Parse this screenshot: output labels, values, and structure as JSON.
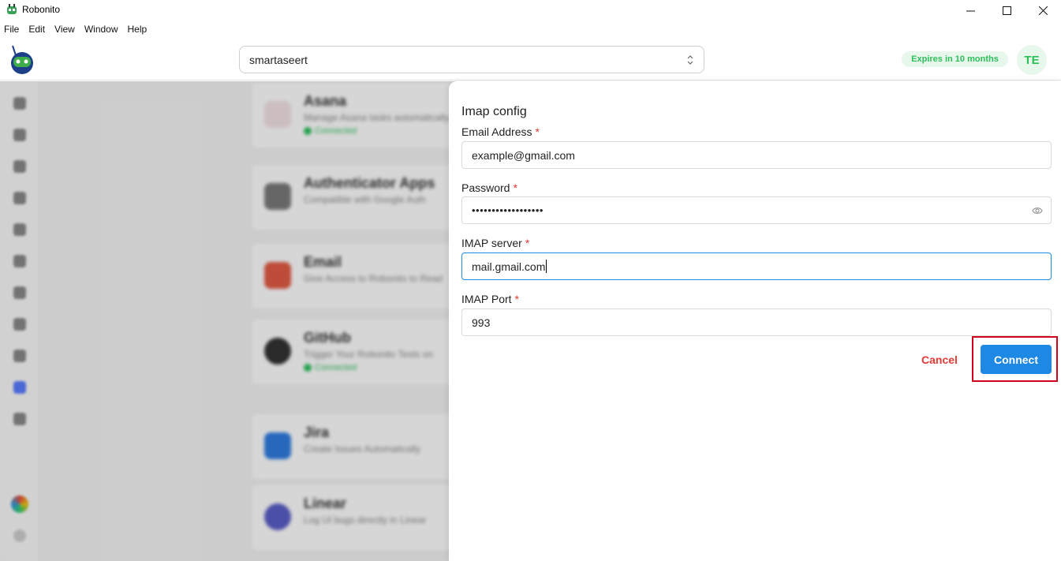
{
  "window": {
    "title": "Robonito",
    "controls": {
      "minimize": "—",
      "maximize": "☐",
      "close": "✕"
    }
  },
  "menu": [
    "File",
    "Edit",
    "View",
    "Window",
    "Help"
  ],
  "header": {
    "workspace": "smartaseert",
    "expiry": "Expires in 10 months",
    "avatar_initials": "TE"
  },
  "background_cards": [
    {
      "title": "Asana",
      "desc": "Manage Asana tasks automatically",
      "status": "Connected",
      "icon_color": "#e8e8e8"
    },
    {
      "title": "Authenticator Apps",
      "desc": "Compatible with Google Auth",
      "status": "",
      "icon_color": "#7a7a7a"
    },
    {
      "title": "Email",
      "desc": "Give Access to Robonito to Read",
      "status": "",
      "icon_color": "#e25b45"
    },
    {
      "title": "GitHub",
      "desc": "Trigger Your Robonito Tests on",
      "status": "Connected",
      "icon_color": "#333333"
    },
    {
      "title": "Jira",
      "desc": "Create Issues Automatically",
      "status": "",
      "icon_color": "#2f7de1"
    },
    {
      "title": "Linear",
      "desc": "Log UI bugs directly in Linear",
      "status": "",
      "icon_color": "#5a5fc8"
    }
  ],
  "form": {
    "title": "Imap config",
    "email_label": "Email Address",
    "email_value": "example@gmail.com",
    "password_label": "Password",
    "password_value": "••••••••••••••••••",
    "imap_server_label": "IMAP server",
    "imap_server_value": "mail.gmail.com",
    "imap_port_label": "IMAP Port",
    "imap_port_value": "993",
    "required_mark": "*",
    "cancel_label": "Cancel",
    "connect_label": "Connect"
  },
  "colors": {
    "accent": "#1e88e5",
    "danger": "#e53935",
    "success": "#2bbf5a",
    "highlight": "#d0021b"
  }
}
